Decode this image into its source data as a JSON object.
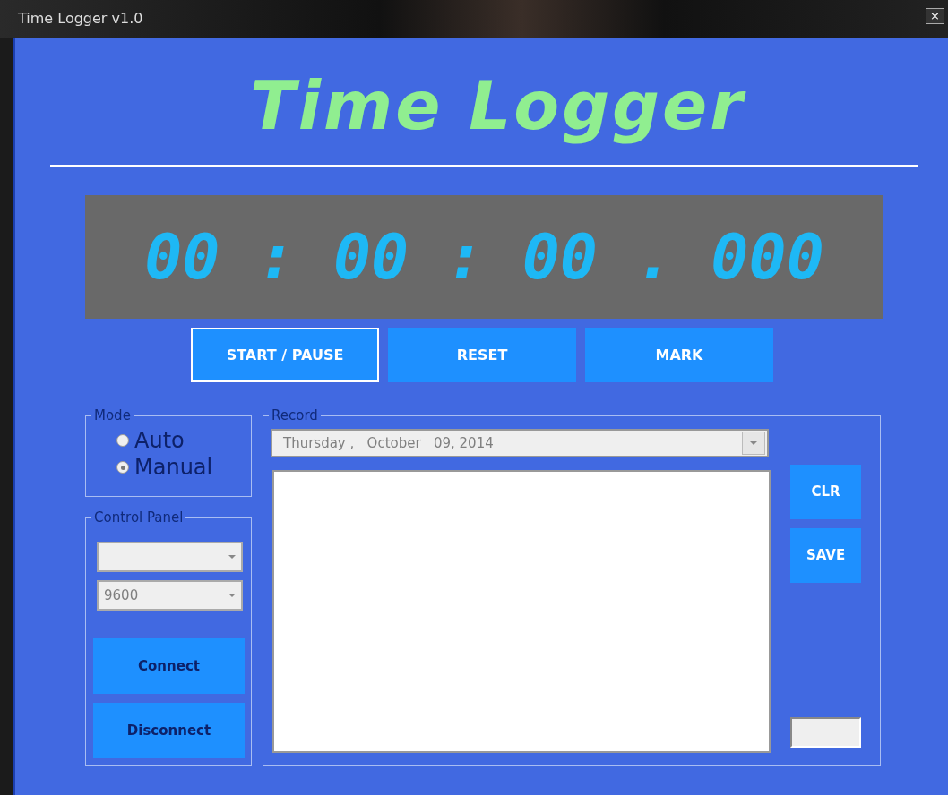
{
  "window": {
    "title": "Time Logger v1.0",
    "close": "×"
  },
  "heading": "Time Logger",
  "timer": "00 : 00 : 00 . 000",
  "buttons": [
    {
      "label": "START / PAUSE",
      "focused": true
    },
    {
      "label": "RESET",
      "focused": false
    },
    {
      "label": "MARK",
      "focused": false
    }
  ],
  "mode": {
    "legend": "Mode",
    "options": [
      {
        "label": "Auto",
        "selected": false
      },
      {
        "label": "Manual",
        "selected": true
      }
    ]
  },
  "control_panel": {
    "legend": "Control Panel",
    "baud": {
      "value": "9600"
    },
    "buttons": [
      "Connect",
      "Disconnect"
    ]
  },
  "record": {
    "legend": "Record",
    "date": "Thursday ,   October   09, 2014",
    "buttons": [
      "CLR",
      "SAVE"
    ]
  }
}
